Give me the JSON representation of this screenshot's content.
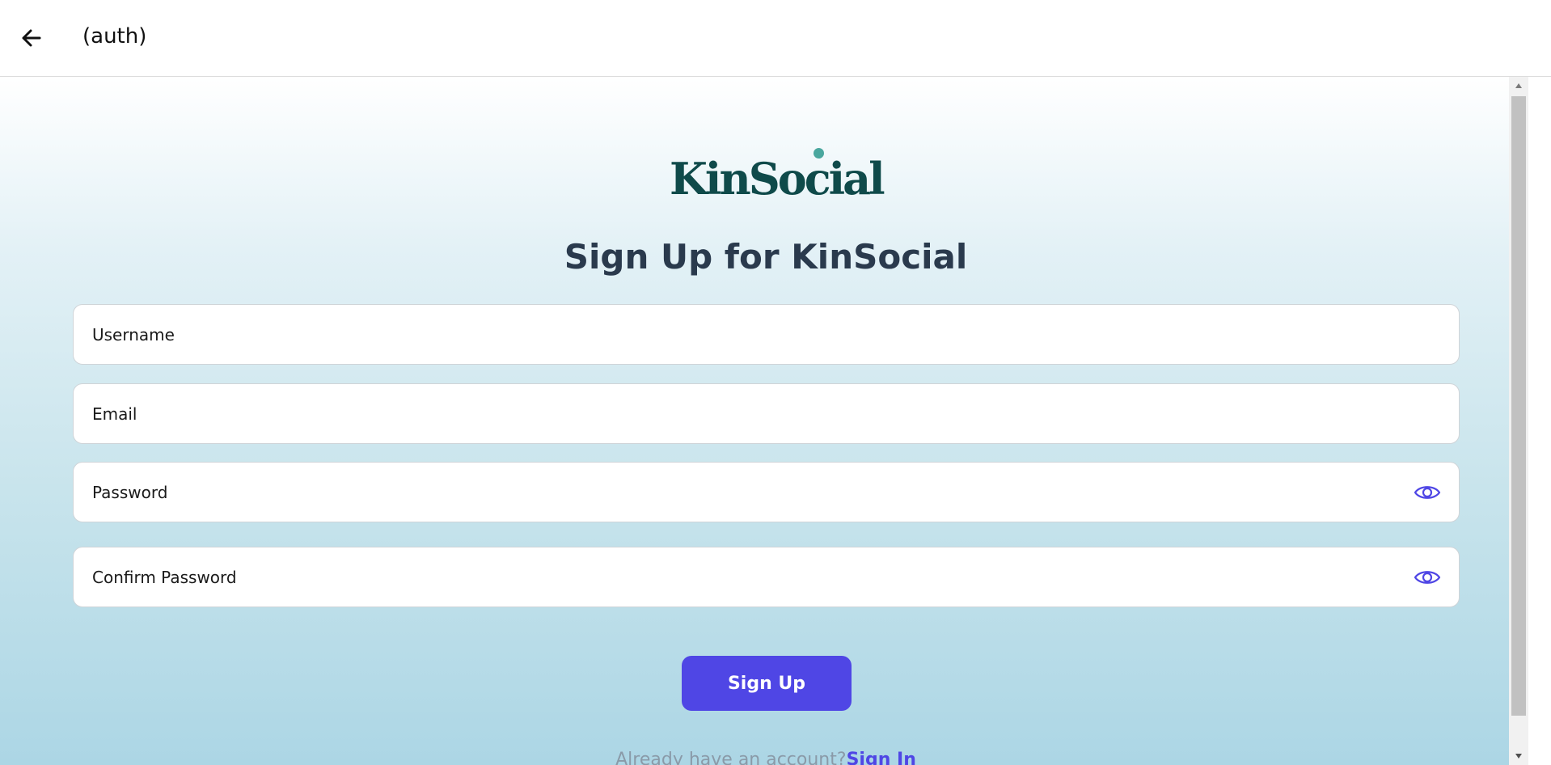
{
  "header": {
    "title": "(auth)",
    "back_icon": "arrow-left-icon"
  },
  "logo": {
    "text": "KinSocial",
    "text_color": "#0f4a4a",
    "dot_color": "#4aa79e"
  },
  "form": {
    "title": "Sign Up for KinSocial",
    "username": {
      "placeholder": "Username",
      "value": ""
    },
    "email": {
      "placeholder": "Email",
      "value": ""
    },
    "password": {
      "placeholder": "Password",
      "value": "",
      "toggle_icon": "eye-icon"
    },
    "confirm_password": {
      "placeholder": "Confirm Password",
      "value": "",
      "toggle_icon": "eye-icon"
    },
    "submit_label": "Sign Up"
  },
  "footer": {
    "prompt": "Already have an account?",
    "link_label": "Sign In"
  },
  "colors": {
    "accent": "#4f46e5",
    "title": "#2a3a4d",
    "gradient_top": "#ffffff",
    "gradient_bottom": "#acd6e5"
  }
}
